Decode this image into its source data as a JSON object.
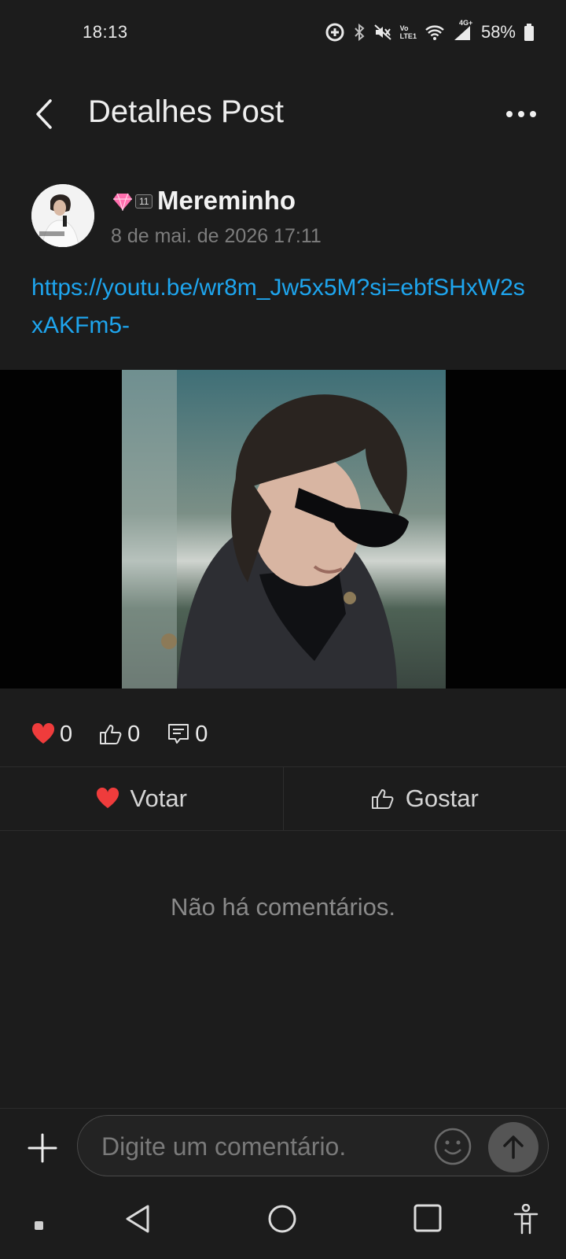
{
  "status": {
    "time": "18:13",
    "battery": "58%",
    "network_top": "4G+",
    "volte_line1": "Vo",
    "volte_line2": "LTE1"
  },
  "header": {
    "title": "Detalhes Post"
  },
  "post": {
    "author": "Mereminho",
    "level": "11",
    "date": "8 de mai. de 2026 17:11",
    "link": "https://youtu.be/wr8m_Jw5x5M?si=ebfSHxW2sxAKFm5-"
  },
  "reactions": {
    "hearts": "0",
    "likes": "0",
    "comments": "0"
  },
  "actions": {
    "vote_label": "Votar",
    "like_label": "Gostar"
  },
  "comments": {
    "empty_text": "Não há comentários."
  },
  "composer": {
    "placeholder": "Digite um comentário."
  },
  "colors": {
    "background": "#1c1c1c",
    "link": "#1ea5ee",
    "heart": "#ef3c3c"
  },
  "icons": [
    "back-arrow-icon",
    "more-dots-icon",
    "heart-icon",
    "thumbs-up-icon",
    "comment-icon",
    "plus-icon",
    "emoji-icon",
    "send-arrow-icon",
    "nav-back-icon",
    "nav-home-icon",
    "nav-recents-icon",
    "accessibility-icon"
  ]
}
